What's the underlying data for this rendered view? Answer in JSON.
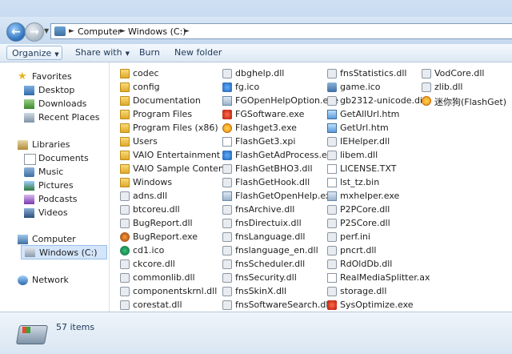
{
  "address": {
    "crumbs": [
      "Computer",
      "Windows (C:)"
    ]
  },
  "toolbar": {
    "organize": "Organize",
    "share": "Share with",
    "burn": "Burn",
    "new_folder": "New folder"
  },
  "nav": {
    "favorites": "Favorites",
    "desktop": "Desktop",
    "downloads": "Downloads",
    "recent": "Recent Places",
    "libraries": "Libraries",
    "documents": "Documents",
    "music": "Music",
    "pictures": "Pictures",
    "podcasts": "Podcasts",
    "videos": "Videos",
    "computer": "Computer",
    "windows_c": "Windows (C:)",
    "network": "Network"
  },
  "files": {
    "col1": [
      "codec",
      "config",
      "Documentation",
      "Program Files",
      "Program Files (x86)",
      "Users",
      "VAIO Entertainment",
      "VAIO Sample Contents",
      "Windows",
      "adns.dll",
      "btcoreu.dll",
      "BugReport.dll",
      "BugReport.exe",
      "cd1.ico",
      "ckcore.dll",
      "commonlib.dll",
      "componentskrnl.dll",
      "corestat.dll"
    ],
    "col2": [
      "dbghelp.dll",
      "fg.ico",
      "FGOpenHelpOption.exe",
      "FGSoftware.exe",
      "Flashget3.exe",
      "FlashGet3.xpi",
      "FlashGetAdProcess.exe",
      "FlashGetBHO3.dll",
      "FlashGetHook.dll",
      "FlashGetOpenHelp.exe",
      "fnsArchive.dll",
      "fnsDirectuix.dll",
      "fnsLanguage.dll",
      "fnslanguage_en.dll",
      "fnsScheduler.dll",
      "fnsSecurity.dll",
      "fnsSkinX.dll",
      "fnsSoftwareSearch.dll"
    ],
    "col3": [
      "fnsStatistics.dll",
      "game.ico",
      "gb2312-unicode.dic",
      "GetAllUrl.htm",
      "GetUrl.htm",
      "IEHelper.dll",
      "libem.dll",
      "LICENSE.TXT",
      "lst_tz.bin",
      "mxhelper.exe",
      "P2PCore.dll",
      "P2SCore.dll",
      "perf.ini",
      "pncrt.dll",
      "RdOldDb.dll",
      "RealMediaSplitter.ax",
      "storage.dll",
      "SysOptimize.exe"
    ],
    "col4": [
      "VodCore.dll",
      "zlib.dll",
      "迷你狗(FlashGet)"
    ]
  },
  "status": {
    "count": "57 items"
  }
}
